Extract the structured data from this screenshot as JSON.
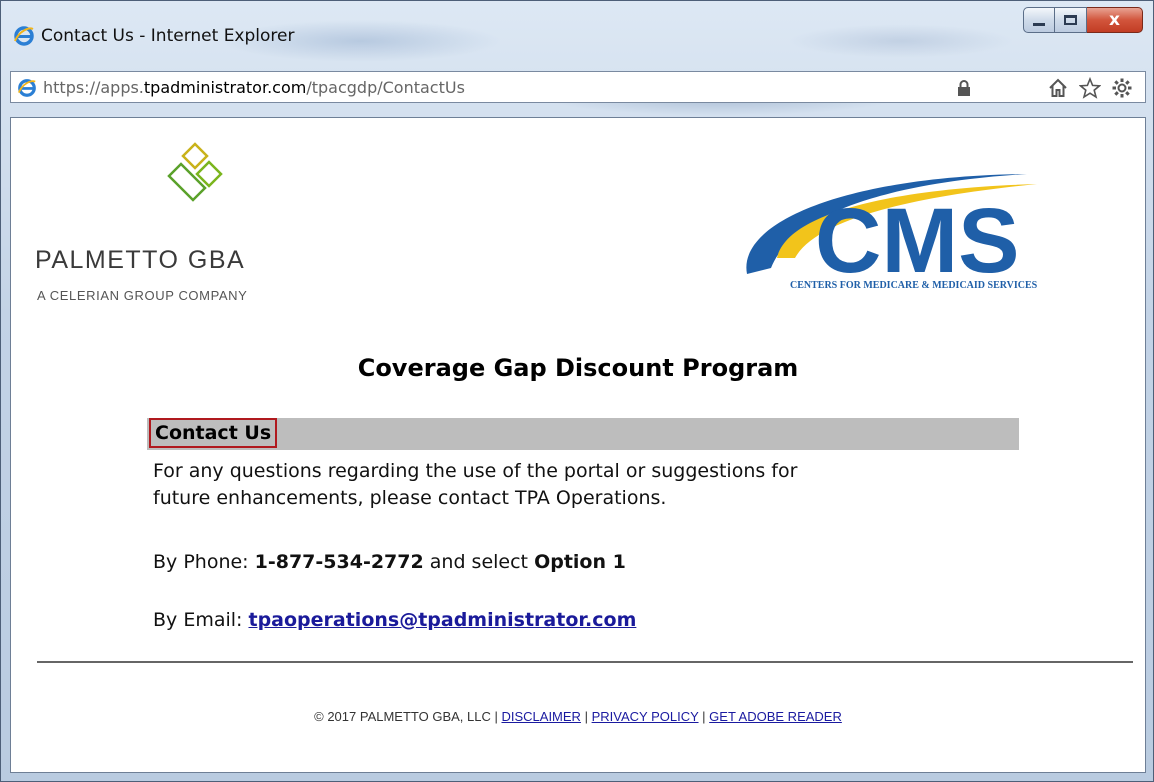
{
  "window": {
    "title": "Contact Us - Internet Explorer",
    "close_label": "x"
  },
  "address_bar": {
    "url_scheme": "https://apps.",
    "url_host": "tpadministrator.com",
    "url_path": "/tpacgdp/ContactUs"
  },
  "header": {
    "palmetto_name": "PALMETTO GBA",
    "palmetto_sub": "A CELERIAN GROUP COMPANY",
    "cms_logo_text": "CMS",
    "cms_tagline": "CENTERS FOR MEDICARE & MEDICAID SERVICES"
  },
  "main": {
    "program_title": "Coverage Gap Discount Program",
    "section_heading": "Contact Us",
    "intro_line1": "For any questions regarding the use of the portal or suggestions for",
    "intro_line2": "future enhancements, please contact TPA Operations.",
    "phone_label": "By Phone:",
    "phone_number": "1-877-534-2772",
    "phone_mid": "and select",
    "phone_option": "Option 1",
    "email_label": "By Email:",
    "email_address": "tpaoperations@tpadministrator.com"
  },
  "footer": {
    "copyright": "© 2017 PALMETTO GBA, LLC |",
    "sep": "|",
    "disclaimer": "DISCLAIMER",
    "privacy": "PRIVACY POLICY",
    "adobe": "GET ADOBE READER"
  },
  "colors": {
    "accent_border": "#b0191e",
    "section_bar": "#bdbdbd",
    "link": "#1a1a9a",
    "cms_blue": "#1f5fa8",
    "cms_yellow": "#f2c41b",
    "palmetto_green": "#7ab51d"
  },
  "icons": [
    "ie-icon",
    "lock-icon",
    "home-icon",
    "favorites-star-icon",
    "settings-gear-icon",
    "palmetto-logo-icon",
    "cms-logo"
  ]
}
